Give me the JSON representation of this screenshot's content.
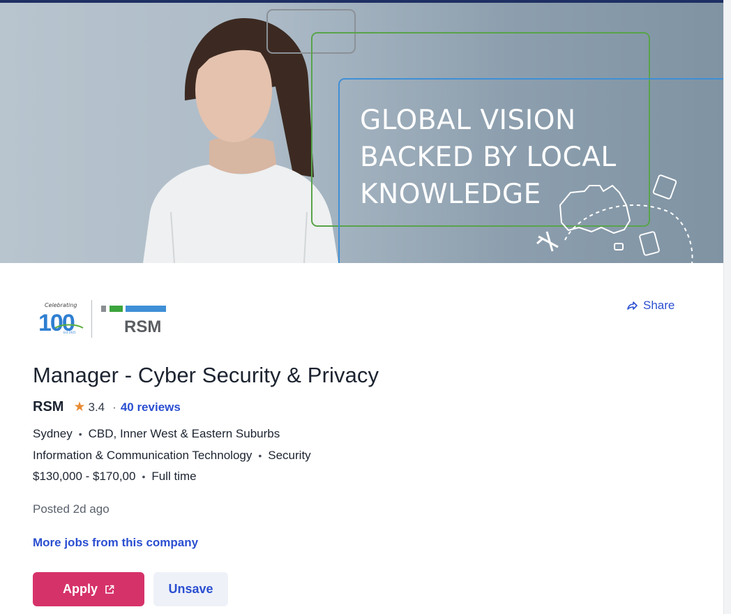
{
  "banner": {
    "lines": [
      "GLOBAL VISION",
      "BACKED BY LOCAL",
      "KNOWLEDGE"
    ]
  },
  "logo": {
    "celebrating": "Celebrating",
    "number": "100",
    "est": "Est.1925",
    "brand": "RSM"
  },
  "share": {
    "label": "Share"
  },
  "job": {
    "title": "Manager - Cyber Security & Privacy",
    "company": "RSM",
    "rating": "3.4",
    "reviews": "40 reviews",
    "location": "Sydney",
    "area": "CBD, Inner West & Eastern Suburbs",
    "classification": "Information & Communication Technology",
    "subclassification": "Security",
    "salary": "$130,000 - $170,00",
    "work_type": "Full time",
    "posted": "Posted 2d ago",
    "more_jobs": "More jobs from this company"
  },
  "actions": {
    "apply_label": "Apply",
    "unsave_label": "Unsave"
  },
  "colors": {
    "accent_link": "#2b4fd1",
    "apply": "#d6326a",
    "star": "#e88b32"
  }
}
